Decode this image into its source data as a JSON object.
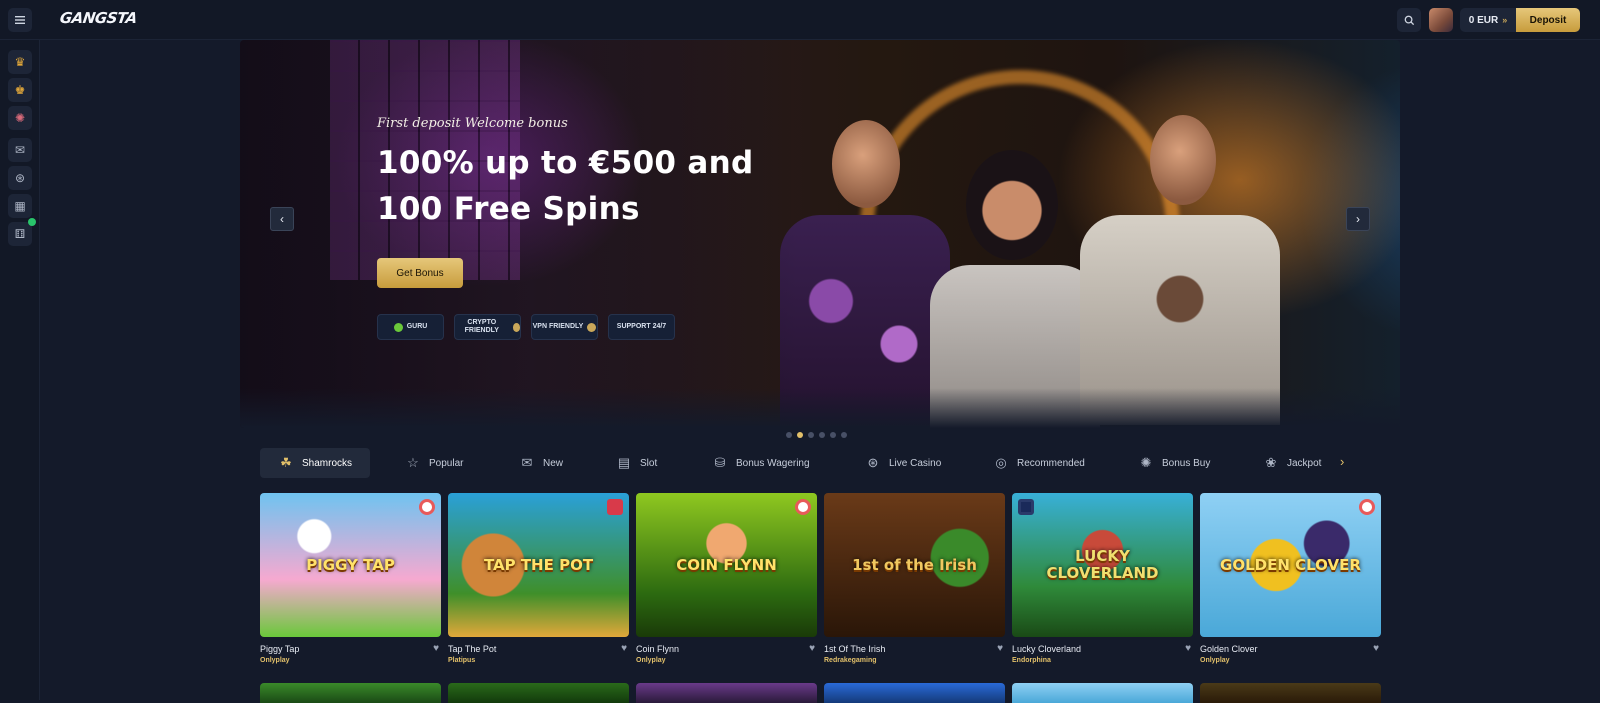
{
  "header": {
    "logo_text": "GANGSTA",
    "balance": "0 EUR",
    "deposit_label": "Deposit"
  },
  "sidebar": {
    "items": [
      {
        "icon": "crown-icon"
      },
      {
        "icon": "trophy-icon"
      },
      {
        "icon": "wheel-icon"
      },
      {
        "icon": "ticket-icon"
      },
      {
        "icon": "chip-icon"
      },
      {
        "icon": "store-icon"
      },
      {
        "icon": "gift-icon"
      }
    ]
  },
  "hero": {
    "subtitle": "First deposit Welcome bonus",
    "title": "100% up to €500 and 100 Free Spins",
    "cta_label": "Get Bonus",
    "badges": [
      "Guru",
      "Crypto Friendly",
      "VPN Friendly",
      "Support 24/7"
    ],
    "slides_total": 6,
    "active_slide": 2
  },
  "tabs": [
    {
      "label": "Shamrocks",
      "icon": "shamrock-icon"
    },
    {
      "label": "Popular",
      "icon": "star-icon"
    },
    {
      "label": "New",
      "icon": "ticket-new-icon"
    },
    {
      "label": "Slot",
      "icon": "slot-machine-icon"
    },
    {
      "label": "Bonus Wagering",
      "icon": "bonus-wagering-icon"
    },
    {
      "label": "Live Casino",
      "icon": "live-casino-icon"
    },
    {
      "label": "Recommended",
      "icon": "recommended-icon"
    },
    {
      "label": "Bonus Buy",
      "icon": "bonus-buy-icon"
    },
    {
      "label": "Jackpot",
      "icon": "jackpot-icon"
    }
  ],
  "games": [
    {
      "title": "Piggy Tap",
      "provider": "Onlyplay",
      "art_text": "PIGGY TAP",
      "colors": [
        "#6fc3f0",
        "#f6a9d0"
      ]
    },
    {
      "title": "Tap The Pot",
      "provider": "Platipus",
      "art_text": "TAP THE POT",
      "colors": [
        "#2aa0d8",
        "#3f8f2a"
      ]
    },
    {
      "title": "Coin Flynn",
      "provider": "Onlyplay",
      "art_text": "COIN FLYNN",
      "colors": [
        "#8fc820",
        "#2c6a10"
      ]
    },
    {
      "title": "1st Of The Irish",
      "provider": "Redrakegaming",
      "art_text": "1st of the Irish",
      "colors": [
        "#6a3a18",
        "#2a1608"
      ]
    },
    {
      "title": "Lucky Cloverland",
      "provider": "Endorphina",
      "art_text": "LUCKY CLOVERLAND",
      "colors": [
        "#38b0d8",
        "#2f8a3a"
      ]
    },
    {
      "title": "Golden Clover",
      "provider": "Onlyplay",
      "art_text": "GOLDEN CLOVER",
      "colors": [
        "#8fd0f4",
        "#4aa8d8"
      ]
    }
  ]
}
